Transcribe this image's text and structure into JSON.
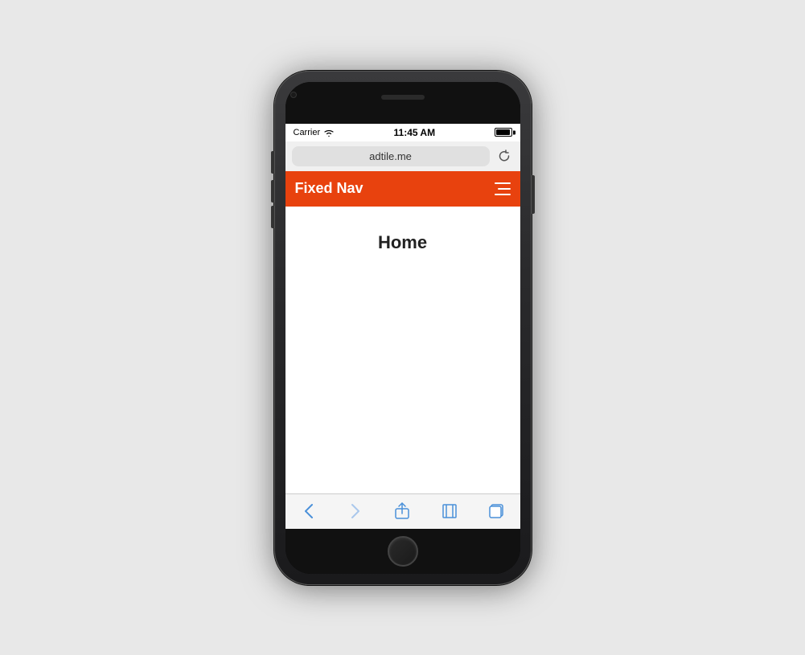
{
  "phone": {
    "status_bar": {
      "carrier": "Carrier",
      "time": "11:45 AM"
    },
    "address_bar": {
      "url": "adtile.me",
      "reload_label": "↻"
    },
    "nav_bar": {
      "title": "Fixed Nav",
      "background_color": "#e8420e",
      "hamburger_label": "☰"
    },
    "content": {
      "heading": "Home"
    },
    "toolbar": {
      "back_label": "‹",
      "forward_label": "›",
      "share_label": "share",
      "bookmarks_label": "bookmarks",
      "tabs_label": "tabs"
    }
  }
}
